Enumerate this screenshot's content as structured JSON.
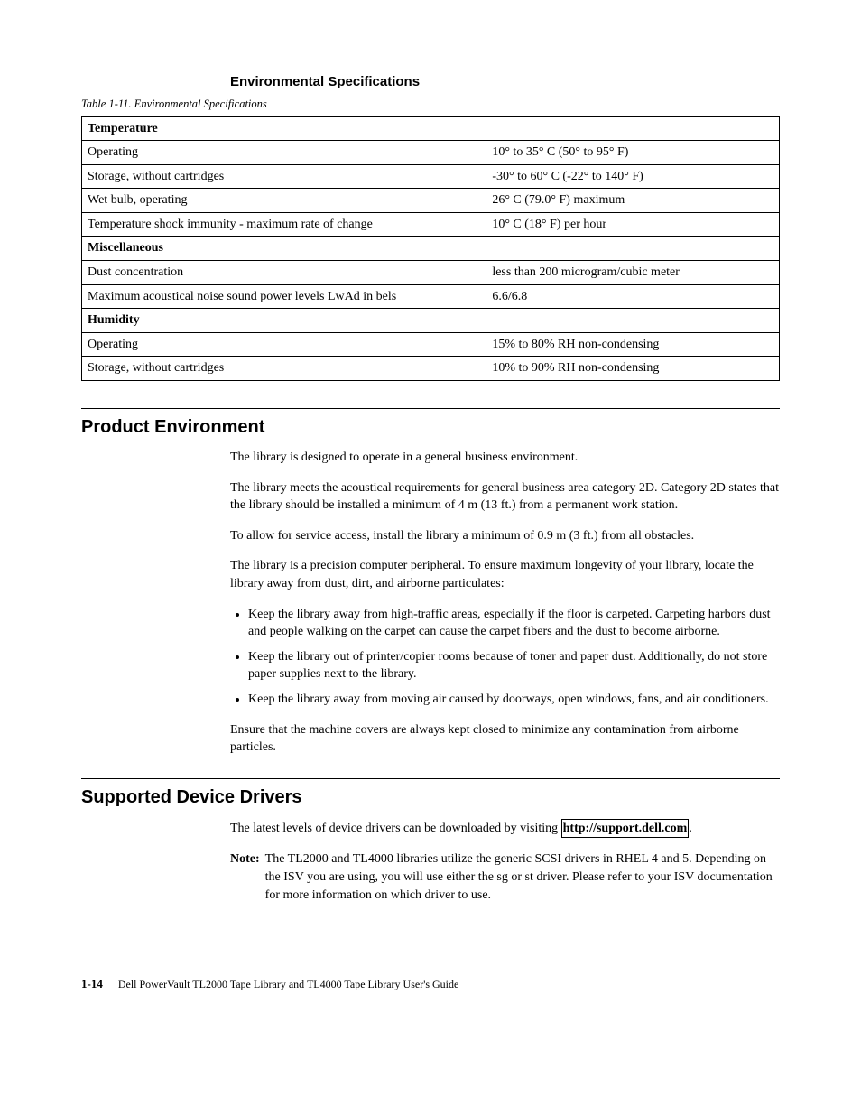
{
  "env_spec": {
    "heading": "Environmental Specifications",
    "caption": "Table 1-11. Environmental Specifications",
    "rows": [
      {
        "type": "group",
        "label": "Temperature"
      },
      {
        "type": "row",
        "label": "Operating",
        "value": "10° to 35° C (50° to 95° F)"
      },
      {
        "type": "row",
        "label": "Storage, without cartridges",
        "value": "-30° to 60° C (-22° to 140° F)"
      },
      {
        "type": "row",
        "label": "Wet bulb, operating",
        "value": "26° C (79.0° F) maximum"
      },
      {
        "type": "row",
        "label": "Temperature shock immunity - maximum rate of change",
        "value": "10° C (18° F) per hour"
      },
      {
        "type": "group",
        "label": "Miscellaneous"
      },
      {
        "type": "row",
        "label": "Dust concentration",
        "value": "less than 200 microgram/cubic meter"
      },
      {
        "type": "row",
        "label": "Maximum acoustical noise sound power levels LwAd in bels",
        "value": "6.6/6.8"
      },
      {
        "type": "group",
        "label": "Humidity"
      },
      {
        "type": "row",
        "label": "Operating",
        "value": "15% to 80% RH non-condensing"
      },
      {
        "type": "row",
        "label": "Storage, without cartridges",
        "value": "10% to 90% RH non-condensing"
      }
    ]
  },
  "product_env": {
    "heading": "Product Environment",
    "p1": "The library is designed to operate in a general business environment.",
    "p2": "The library meets the acoustical requirements for general business area category 2D. Category 2D states that the library should be installed a minimum of 4 m (13 ft.) from a permanent work station.",
    "p3": "To allow for service access, install the library a minimum of 0.9 m (3 ft.) from all obstacles.",
    "p4": "The library is a precision computer peripheral. To ensure maximum longevity of your library, locate the library away from dust, dirt, and airborne particulates:",
    "bullets": [
      "Keep the library away from high-traffic areas, especially if the floor is carpeted. Carpeting harbors dust and people walking on the carpet can cause the carpet fibers and the dust to become airborne.",
      "Keep the library out of printer/copier rooms because of toner and paper dust. Additionally, do not store paper supplies next to the library.",
      "Keep the library away from moving air caused by doorways, open windows, fans, and air conditioners."
    ],
    "p5": "Ensure that the machine covers are always kept closed to minimize any contamination from airborne particles."
  },
  "drivers": {
    "heading": "Supported Device Drivers",
    "p1_a": "The latest levels of device drivers can be downloaded by visiting ",
    "link": "http://support.dell.com",
    "p1_b": ".",
    "note_label": "Note:",
    "note_body": "The TL2000 and TL4000 libraries utilize the generic SCSI drivers in RHEL 4 and 5. Depending on the ISV you are using, you will use either the sg or st driver. Please refer to your ISV documentation for more information on which driver to use."
  },
  "footer": {
    "page": "1-14",
    "text": "Dell PowerVault TL2000 Tape Library and TL4000 Tape Library User's Guide"
  }
}
